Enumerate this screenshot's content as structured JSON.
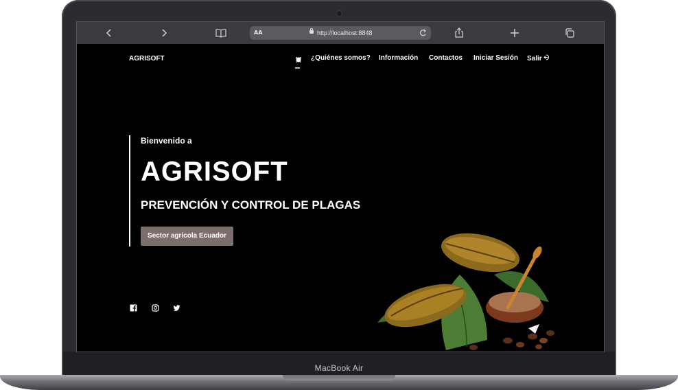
{
  "device": {
    "model_label": "MacBook Air"
  },
  "browser": {
    "text_size_label": "AA",
    "url": "http://localhost:8848",
    "icons": [
      "back-icon",
      "forward-icon",
      "bookmarks-icon",
      "reader-aa-icon",
      "lock-icon",
      "reload-icon",
      "share-icon",
      "new-tab-icon",
      "tabs-icon"
    ]
  },
  "site": {
    "brand": "AGRISOFT",
    "nav": {
      "home_icon": "home-icon",
      "items": [
        "¿Quiénes somos?",
        "Información",
        "Contactos",
        "Iniciar Sesión",
        "Salir"
      ],
      "logout_icon": "logout-icon"
    },
    "hero": {
      "welcome": "Bienvenido a",
      "title": "AGRISOFT",
      "subtitle": "PREVENCIÓN Y CONTROL DE PLAGAS",
      "cta_label": "Sector agrícola Ecuador"
    },
    "social": [
      "facebook-icon",
      "instagram-icon",
      "twitter-icon"
    ],
    "image": "cacao-pods-with-cocoa-powder-bowl"
  },
  "colors": {
    "page_bg": "#000000",
    "cta_bg": "#7d6e6d",
    "toolbar_bg": "#3a3b3e",
    "address_bg": "#5a5b5f"
  }
}
